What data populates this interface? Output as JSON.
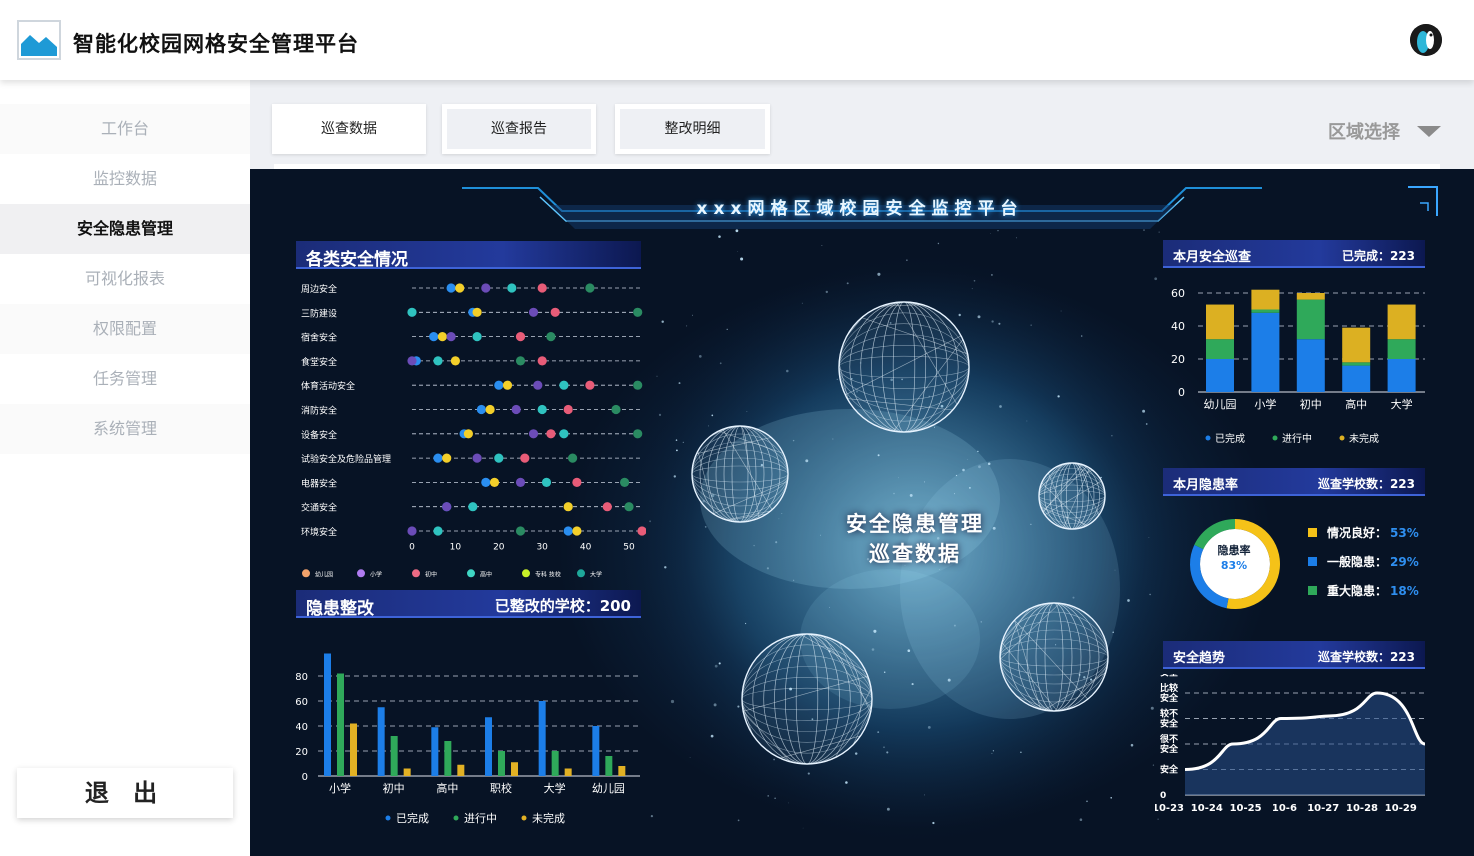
{
  "app": {
    "title": "智能化校园网格安全管理平台"
  },
  "sidebar": {
    "items": [
      {
        "label": "工作台"
      },
      {
        "label": "监控数据"
      },
      {
        "label": "安全隐患管理"
      },
      {
        "label": "可视化报表"
      },
      {
        "label": "权限配置"
      },
      {
        "label": "任务管理"
      },
      {
        "label": "系统管理"
      }
    ],
    "active": "安全隐患管理",
    "logout": "退 出"
  },
  "tabs": [
    {
      "label": "巡查数据"
    },
    {
      "label": "巡查报告"
    },
    {
      "label": "整改明细"
    }
  ],
  "region_select": {
    "label": "区域选择"
  },
  "dashboard": {
    "banner": "xxx网格区域校园安全监控平台",
    "center_lines": [
      "安全隐患管理",
      "巡查数据"
    ],
    "panel_safety": {
      "title": "各类安全情况"
    },
    "panel_rectify": {
      "title": "隐患整改",
      "right": "已整改的学校：200"
    },
    "panel_patrol": {
      "title": "本月安全巡查",
      "right": "已完成：223"
    },
    "panel_hazard": {
      "title": "本月隐患率",
      "right": "巡查学校数：223",
      "center_label": "隐患率",
      "center_value": "83%"
    },
    "panel_trend": {
      "title": "安全趋势",
      "right": "巡查学校数：223"
    }
  },
  "chart_data": [
    {
      "type": "scatter",
      "title": "各类安全情况",
      "categories": [
        "周边安全",
        "三防建设",
        "宿舍安全",
        "食堂安全",
        "体育活动安全",
        "消防安全",
        "设备安全",
        "试验安全及危险品管理",
        "电器安全",
        "交通安全",
        "环境安全"
      ],
      "xlim": [
        0,
        53
      ],
      "xticks": [
        0,
        10,
        20,
        30,
        40,
        50
      ],
      "legend": [
        "幼儿园",
        "小学",
        "初中",
        "高中",
        "专科 技校",
        "大学"
      ],
      "legend_colors": [
        "#f2a26b",
        "#b07cf2",
        "#ec6a84",
        "#3fd6c4",
        "#c8f028",
        "#1ea89a"
      ],
      "series": [
        {
          "name": "幼儿园",
          "color": "#2a8ef0",
          "values": [
            9,
            14,
            5,
            1,
            20,
            16,
            12,
            6,
            17,
            8,
            36
          ]
        },
        {
          "name": "小学",
          "color": "#f3cf2a",
          "values": [
            11,
            15,
            7,
            10,
            22,
            18,
            13,
            8,
            19,
            36,
            38
          ]
        },
        {
          "name": "初中",
          "color": "#6b4cb8",
          "values": [
            17,
            28,
            9,
            0,
            29,
            24,
            28,
            15,
            25,
            8,
            0
          ]
        },
        {
          "name": "高中",
          "color": "#2fc3c0",
          "values": [
            23,
            0,
            15,
            6,
            35,
            30,
            35,
            20,
            31,
            14,
            6
          ]
        },
        {
          "name": "专科 技校",
          "color": "#e85c78",
          "values": [
            30,
            33,
            25,
            30,
            41,
            36,
            32,
            26,
            38,
            45,
            53
          ]
        },
        {
          "name": "大学",
          "color": "#2a8b62",
          "values": [
            41,
            52,
            32,
            25,
            52,
            47,
            52,
            37,
            49,
            50,
            25
          ]
        }
      ]
    },
    {
      "type": "bar",
      "title": "隐患整改",
      "categories": [
        "小学",
        "初中",
        "高中",
        "职校",
        "大学",
        "幼儿园"
      ],
      "ylim": [
        0,
        100
      ],
      "yticks": [
        0,
        20,
        40,
        60,
        80
      ],
      "series": [
        {
          "name": "已完成",
          "color": "#1c7ee8",
          "values": [
            98,
            55,
            39,
            47,
            60,
            40
          ]
        },
        {
          "name": "进行中",
          "color": "#2fa95a",
          "values": [
            82,
            32,
            28,
            20,
            20,
            16
          ]
        },
        {
          "name": "未完成",
          "color": "#e2b124",
          "values": [
            42,
            6,
            9,
            11,
            6,
            8
          ]
        }
      ]
    },
    {
      "type": "bar",
      "stacked": true,
      "title": "本月安全巡查",
      "categories": [
        "幼儿园",
        "小学",
        "初中",
        "高中",
        "大学"
      ],
      "ylim": [
        0,
        65
      ],
      "yticks": [
        0,
        20,
        40,
        60
      ],
      "series": [
        {
          "name": "已完成",
          "color": "#1c7ee8",
          "values": [
            20,
            48,
            32,
            16,
            20
          ]
        },
        {
          "name": "进行中",
          "color": "#2fa95a",
          "values": [
            12,
            2,
            24,
            2,
            12
          ]
        },
        {
          "name": "未完成",
          "color": "#dcb022",
          "values": [
            21,
            12,
            4,
            21,
            21
          ]
        }
      ]
    },
    {
      "type": "pie",
      "title": "本月隐患率",
      "labels": [
        "情况良好：",
        "一般隐患：",
        "重大隐患："
      ],
      "values": [
        53,
        29,
        18
      ],
      "value_labels": [
        "53%",
        "29%",
        "18%"
      ],
      "colors": [
        "#f5c218",
        "#1c7ee8",
        "#2fa95a"
      ]
    },
    {
      "type": "area",
      "title": "安全趋势",
      "x": [
        "10-23",
        "10-24",
        "10-25",
        "10-6",
        "10-27",
        "10-28",
        "10-29"
      ],
      "y": [
        1,
        2,
        3,
        3.1,
        4,
        2
      ],
      "ylabels": [
        "0",
        "安全",
        "很不安全",
        "较不安全",
        "比较安全",
        "非常安全"
      ],
      "grid": true
    }
  ]
}
